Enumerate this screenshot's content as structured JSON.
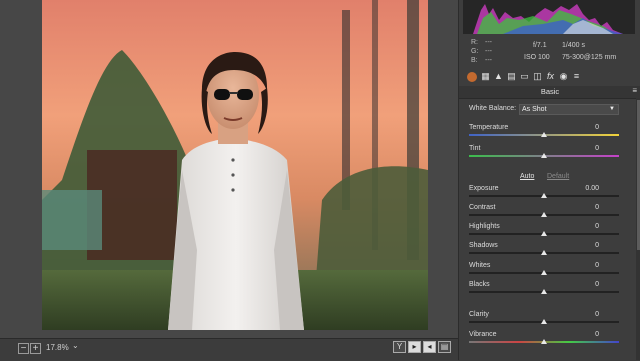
{
  "camera": {
    "r_label": "R:",
    "g_label": "G:",
    "b_label": "B:",
    "r_value": "---",
    "g_value": "---",
    "b_value": "---",
    "aperture": "f/7.1",
    "shutter": "1/400 s",
    "iso": "ISO 100",
    "lens": "75-300@125 mm"
  },
  "toolbar": {
    "icons": [
      "basic-icon",
      "tone-curve-icon",
      "detail-icon",
      "hsl-icon",
      "split-toning-icon",
      "lens-corrections-icon",
      "effects-icon",
      "camera-calibration-icon",
      "presets-icon"
    ]
  },
  "panel": {
    "section_title": "Basic",
    "white_balance_label": "White Balance:",
    "white_balance_value": "As Shot",
    "auto_label": "Auto",
    "default_label": "Default",
    "sliders": [
      {
        "label": "Temperature",
        "value": "0",
        "level": 0.5
      },
      {
        "label": "Tint",
        "value": "0",
        "level": 0.5
      },
      {
        "label": "Exposure",
        "value": "0.00",
        "level": 0.5
      },
      {
        "label": "Contrast",
        "value": "0",
        "level": 0.5
      },
      {
        "label": "Highlights",
        "value": "0",
        "level": 0.5
      },
      {
        "label": "Shadows",
        "value": "0",
        "level": 0.5
      },
      {
        "label": "Whites",
        "value": "0",
        "level": 0.5
      },
      {
        "label": "Blacks",
        "value": "0",
        "level": 0.5
      },
      {
        "label": "Clarity",
        "value": "0",
        "level": 0.5
      },
      {
        "label": "Vibrance",
        "value": "0",
        "level": 0.5
      }
    ]
  },
  "bottom_bar": {
    "zoom": "17.8%",
    "zoom_out_label": "−",
    "zoom_in_label": "+",
    "view_buttons": [
      "Y",
      "▸",
      "◂",
      "▤"
    ]
  },
  "colors": {
    "panel_bg": "#3d3d3d",
    "temperature_gradient": [
      "#3f63c7",
      "#f2d33a"
    ],
    "tint_gradient": [
      "#3bbd4c",
      "#c541c9"
    ]
  }
}
